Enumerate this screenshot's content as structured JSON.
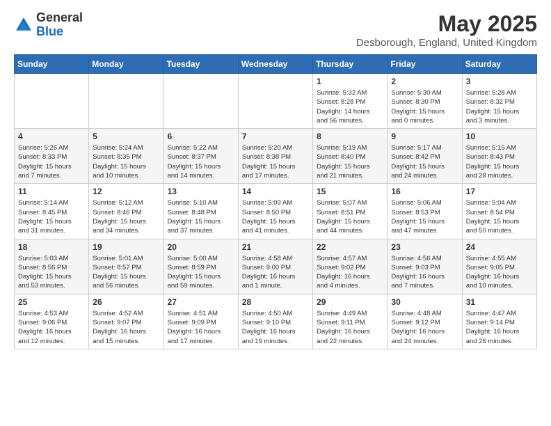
{
  "header": {
    "logo_line1": "General",
    "logo_line2": "Blue",
    "month_title": "May 2025",
    "location": "Desborough, England, United Kingdom"
  },
  "weekdays": [
    "Sunday",
    "Monday",
    "Tuesday",
    "Wednesday",
    "Thursday",
    "Friday",
    "Saturday"
  ],
  "weeks": [
    [
      {
        "day": "",
        "text": ""
      },
      {
        "day": "",
        "text": ""
      },
      {
        "day": "",
        "text": ""
      },
      {
        "day": "",
        "text": ""
      },
      {
        "day": "1",
        "text": "Sunrise: 5:32 AM\nSunset: 8:28 PM\nDaylight: 14 hours\nand 56 minutes."
      },
      {
        "day": "2",
        "text": "Sunrise: 5:30 AM\nSunset: 8:30 PM\nDaylight: 15 hours\nand 0 minutes."
      },
      {
        "day": "3",
        "text": "Sunrise: 5:28 AM\nSunset: 8:32 PM\nDaylight: 15 hours\nand 3 minutes."
      }
    ],
    [
      {
        "day": "4",
        "text": "Sunrise: 5:26 AM\nSunset: 8:33 PM\nDaylight: 15 hours\nand 7 minutes."
      },
      {
        "day": "5",
        "text": "Sunrise: 5:24 AM\nSunset: 8:35 PM\nDaylight: 15 hours\nand 10 minutes."
      },
      {
        "day": "6",
        "text": "Sunrise: 5:22 AM\nSunset: 8:37 PM\nDaylight: 15 hours\nand 14 minutes."
      },
      {
        "day": "7",
        "text": "Sunrise: 5:20 AM\nSunset: 8:38 PM\nDaylight: 15 hours\nand 17 minutes."
      },
      {
        "day": "8",
        "text": "Sunrise: 5:19 AM\nSunset: 8:40 PM\nDaylight: 15 hours\nand 21 minutes."
      },
      {
        "day": "9",
        "text": "Sunrise: 5:17 AM\nSunset: 8:42 PM\nDaylight: 15 hours\nand 24 minutes."
      },
      {
        "day": "10",
        "text": "Sunrise: 5:15 AM\nSunset: 8:43 PM\nDaylight: 15 hours\nand 28 minutes."
      }
    ],
    [
      {
        "day": "11",
        "text": "Sunrise: 5:14 AM\nSunset: 8:45 PM\nDaylight: 15 hours\nand 31 minutes."
      },
      {
        "day": "12",
        "text": "Sunrise: 5:12 AM\nSunset: 8:46 PM\nDaylight: 15 hours\nand 34 minutes."
      },
      {
        "day": "13",
        "text": "Sunrise: 5:10 AM\nSunset: 8:48 PM\nDaylight: 15 hours\nand 37 minutes."
      },
      {
        "day": "14",
        "text": "Sunrise: 5:09 AM\nSunset: 8:50 PM\nDaylight: 15 hours\nand 41 minutes."
      },
      {
        "day": "15",
        "text": "Sunrise: 5:07 AM\nSunset: 8:51 PM\nDaylight: 15 hours\nand 44 minutes."
      },
      {
        "day": "16",
        "text": "Sunrise: 5:06 AM\nSunset: 8:53 PM\nDaylight: 15 hours\nand 47 minutes."
      },
      {
        "day": "17",
        "text": "Sunrise: 5:04 AM\nSunset: 8:54 PM\nDaylight: 15 hours\nand 50 minutes."
      }
    ],
    [
      {
        "day": "18",
        "text": "Sunrise: 5:03 AM\nSunset: 8:56 PM\nDaylight: 15 hours\nand 53 minutes."
      },
      {
        "day": "19",
        "text": "Sunrise: 5:01 AM\nSunset: 8:57 PM\nDaylight: 15 hours\nand 56 minutes."
      },
      {
        "day": "20",
        "text": "Sunrise: 5:00 AM\nSunset: 8:59 PM\nDaylight: 15 hours\nand 59 minutes."
      },
      {
        "day": "21",
        "text": "Sunrise: 4:58 AM\nSunset: 9:00 PM\nDaylight: 16 hours\nand 1 minute."
      },
      {
        "day": "22",
        "text": "Sunrise: 4:57 AM\nSunset: 9:02 PM\nDaylight: 16 hours\nand 4 minutes."
      },
      {
        "day": "23",
        "text": "Sunrise: 4:56 AM\nSunset: 9:03 PM\nDaylight: 16 hours\nand 7 minutes."
      },
      {
        "day": "24",
        "text": "Sunrise: 4:55 AM\nSunset: 9:05 PM\nDaylight: 16 hours\nand 10 minutes."
      }
    ],
    [
      {
        "day": "25",
        "text": "Sunrise: 4:53 AM\nSunset: 9:06 PM\nDaylight: 16 hours\nand 12 minutes."
      },
      {
        "day": "26",
        "text": "Sunrise: 4:52 AM\nSunset: 9:07 PM\nDaylight: 16 hours\nand 15 minutes."
      },
      {
        "day": "27",
        "text": "Sunrise: 4:51 AM\nSunset: 9:09 PM\nDaylight: 16 hours\nand 17 minutes."
      },
      {
        "day": "28",
        "text": "Sunrise: 4:50 AM\nSunset: 9:10 PM\nDaylight: 16 hours\nand 19 minutes."
      },
      {
        "day": "29",
        "text": "Sunrise: 4:49 AM\nSunset: 9:11 PM\nDaylight: 16 hours\nand 22 minutes."
      },
      {
        "day": "30",
        "text": "Sunrise: 4:48 AM\nSunset: 9:12 PM\nDaylight: 16 hours\nand 24 minutes."
      },
      {
        "day": "31",
        "text": "Sunrise: 4:47 AM\nSunset: 9:14 PM\nDaylight: 16 hours\nand 26 minutes."
      }
    ]
  ]
}
